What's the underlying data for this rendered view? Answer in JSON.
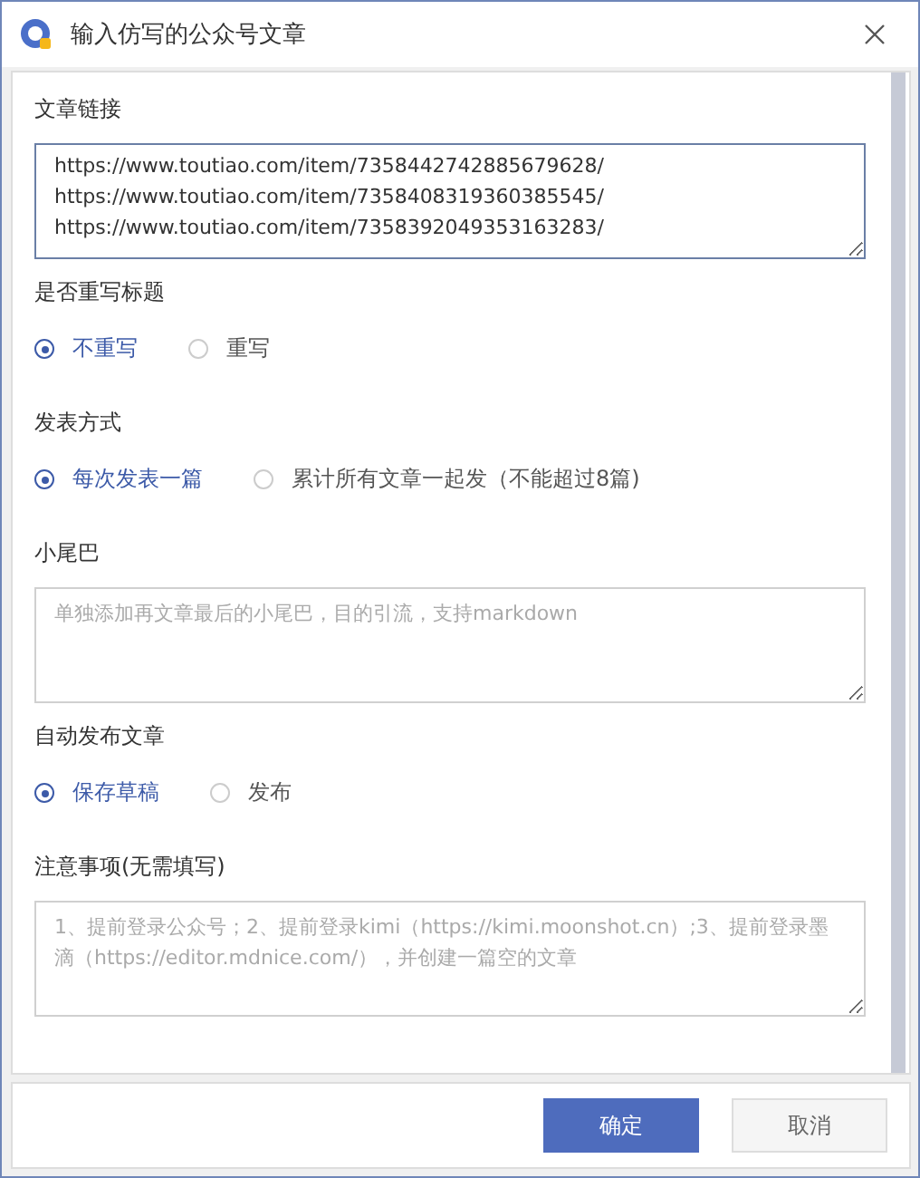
{
  "window": {
    "title": "输入仿写的公众号文章"
  },
  "fields": [
    {
      "kind": "textarea",
      "label": "文章链接",
      "value": "https://www.toutiao.com/item/7358442742885679628/\nhttps://www.toutiao.com/item/7358408319360385545/\nhttps://www.toutiao.com/item/7358392049353163283/"
    },
    {
      "kind": "radio",
      "label": "是否重写标题",
      "options": [
        {
          "label": "不重写",
          "selected": true
        },
        {
          "label": "重写",
          "selected": false
        }
      ]
    },
    {
      "kind": "radio",
      "label": "发表方式",
      "options": [
        {
          "label": "每次发表一篇",
          "selected": true
        },
        {
          "label": "累计所有文章一起发（不能超过8篇)",
          "selected": false
        }
      ]
    },
    {
      "kind": "textarea",
      "label": "小尾巴",
      "placeholder": "单独添加再文章最后的小尾巴，目的引流，支持markdown"
    },
    {
      "kind": "radio",
      "label": "自动发布文章",
      "options": [
        {
          "label": "保存草稿",
          "selected": true
        },
        {
          "label": "发布",
          "selected": false
        }
      ]
    },
    {
      "kind": "textarea",
      "label": "注意事项(无需填写)",
      "placeholder": "1、提前登录公众号；2、提前登录kimi（https://kimi.moonshot.cn）;3、提前登录墨滴（https://editor.mdnice.com/），并创建一篇空的文章"
    }
  ],
  "buttons": [
    {
      "label": "确定",
      "kind": "primary"
    },
    {
      "label": "取消",
      "kind": "default"
    }
  ]
}
